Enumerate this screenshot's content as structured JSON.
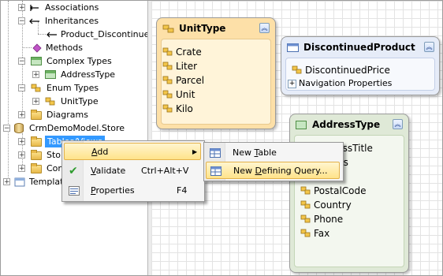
{
  "tree": {
    "items": [
      {
        "label": "Associations"
      },
      {
        "label": "Inheritances"
      },
      {
        "label": "Product_Discontinued"
      },
      {
        "label": "Methods"
      },
      {
        "label": "Complex Types"
      },
      {
        "label": "AddressType"
      },
      {
        "label": "Enum Types"
      },
      {
        "label": "UnitType"
      },
      {
        "label": "Diagrams"
      },
      {
        "label": "CrmDemoModel.Store"
      },
      {
        "label": "Tables/Views"
      },
      {
        "label": "Stor"
      },
      {
        "label": "Con"
      },
      {
        "label": "Templat"
      }
    ]
  },
  "entities": {
    "unittype": {
      "title": "UnitType",
      "values": [
        "Crate",
        "Liter",
        "Parcel",
        "Unit",
        "Kilo"
      ]
    },
    "discontinued": {
      "title": "DiscontinuedProduct",
      "properties": [
        "DiscontinuedPrice"
      ],
      "nav": "Navigation Properties"
    },
    "address": {
      "title": "AddressType",
      "properties": [
        "dressTitle",
        "ess",
        "PostalCode",
        "Country",
        "Phone",
        "Fax"
      ]
    }
  },
  "context_menu": {
    "add": {
      "prefix": "",
      "u": "A",
      "rest": "dd"
    },
    "validate": {
      "u": "V",
      "rest": "alidate",
      "shortcut": "Ctrl+Alt+V"
    },
    "properties": {
      "u": "P",
      "rest": "roperties",
      "shortcut": "F4"
    }
  },
  "submenu": {
    "new_table": {
      "prefix": "New ",
      "u": "T",
      "rest": "able"
    },
    "new_defining_query": {
      "prefix": "New ",
      "u": "D",
      "rest": "efining Query..."
    }
  },
  "colors": {
    "unittype_fill": "#fde0a8",
    "discontinued_fill": "#e6ecf8",
    "address_fill": "#dfe9d7",
    "selection": "#3399ff",
    "menu_highlight": "#ffe38a"
  }
}
